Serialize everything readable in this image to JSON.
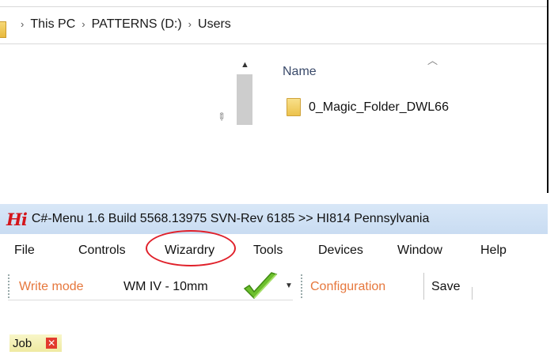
{
  "explorer": {
    "breadcrumb": [
      "This PC",
      "PATTERNS (D:)",
      "Users"
    ],
    "crumb_separator": "›",
    "column_header": "Name",
    "files": [
      {
        "name": "0_Magic_Folder_DWL66",
        "icon": "folder-icon"
      }
    ]
  },
  "app": {
    "logo_text": "Hi",
    "title": "C#-Menu 1.6 Build 5568.13975 SVN-Rev 6185 >> HI814 Pennsylvania",
    "menu": [
      "File",
      "Controls",
      "Wizardry",
      "Tools",
      "Devices",
      "Window",
      "Help"
    ],
    "highlighted_menu": "Wizardry",
    "toolbar": {
      "write_mode_label": "Write mode",
      "write_mode_value": "WM IV - 10mm",
      "configuration_label": "Configuration",
      "save_label": "Save"
    },
    "tab": {
      "label": "Job",
      "close_symbol": "✕"
    }
  },
  "colors": {
    "title_bar": "#c9dcf2",
    "accent_orange": "#e6773c",
    "highlight_red": "#e0202a",
    "tab_yellow": "#efeaa2"
  }
}
